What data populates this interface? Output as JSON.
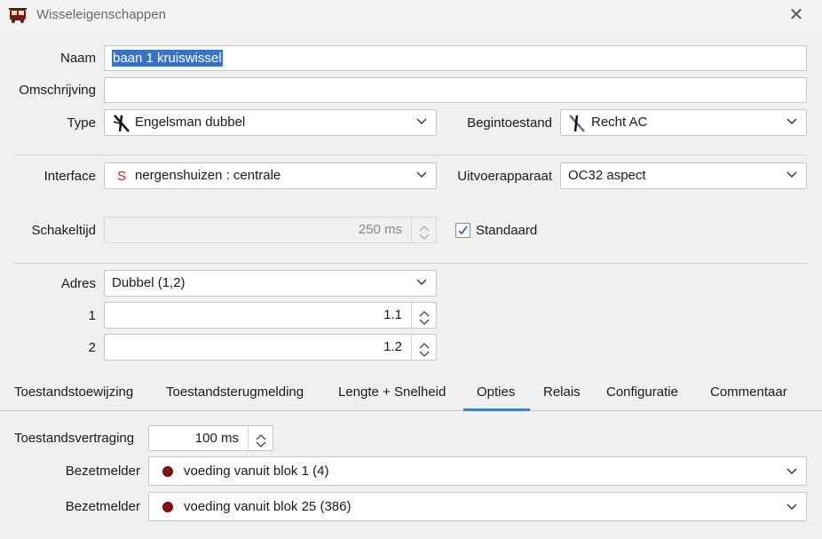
{
  "window": {
    "title": "Wisseleigenschappen",
    "app_icon": "train-icon",
    "close_icon": "close-icon"
  },
  "form": {
    "naam_label": "Naam",
    "naam_value": "baan 1 kruiswissel",
    "omschrijving_label": "Omschrijving",
    "omschrijving_value": "",
    "type_label": "Type",
    "type_value": "Engelsman dubbel",
    "begintoestand_label": "Begintoestand",
    "begintoestand_value": "Recht AC",
    "interface_label": "Interface",
    "interface_prefix": "S",
    "interface_value": "nergenshuizen : centrale",
    "uitvoer_label": "Uitvoerapparaat",
    "uitvoer_value": "OC32 aspect",
    "schakeltijd_label": "Schakeltijd",
    "schakeltijd_value": "250 ms",
    "standaard_label": "Standaard",
    "standaard_checked": true,
    "adres_label": "Adres",
    "adres_value": "Dubbel (1,2)",
    "adres1_label": "1",
    "adres1_value": "1.1",
    "adres2_label": "2",
    "adres2_value": "1.2"
  },
  "tabs": [
    {
      "label": "Toestandstoewijzing",
      "active": false
    },
    {
      "label": "Toestandsterugmelding",
      "active": false
    },
    {
      "label": "Lengte + Snelheid",
      "active": false
    },
    {
      "label": "Opties",
      "active": true
    },
    {
      "label": "Relais",
      "active": false
    },
    {
      "label": "Configuratie",
      "active": false
    },
    {
      "label": "Commentaar",
      "active": false
    }
  ],
  "opties": {
    "vertraging_label": "Toestandsvertraging",
    "vertraging_value": "100 ms",
    "bezetmelder1_label": "Bezetmelder",
    "bezetmelder1_value": "voeding vanuit blok 1 (4)",
    "bezetmelder2_label": "Bezetmelder",
    "bezetmelder2_value": "voeding vanuit blok 25 (386)"
  },
  "colors": {
    "accent": "#4a7fc1",
    "selection": "#3a72c4",
    "occupancy_dot": "#8b1010",
    "interface_s": "#c0281d"
  }
}
